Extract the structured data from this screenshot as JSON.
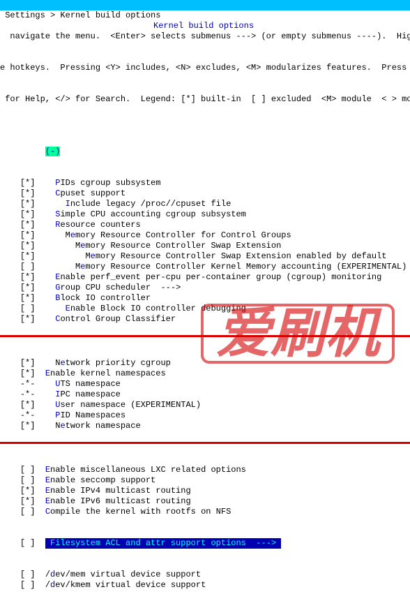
{
  "titlebar": {
    "breadcrumb": " Settings > Kernel build options",
    "title": "Kernel build options"
  },
  "help": {
    "l1": "  navigate the menu.  <Enter> selects submenus ---> (or empty submenus ----).  Highli",
    "l2": "e hotkeys.  Pressing <Y> includes, <N> excludes, <M> modularizes features.  Press <E",
    "l3": " for Help, </> for Search.  Legend: [*] built-in  [ ] excluded  <M> module  < > modul"
  },
  "marker": "(-)",
  "items": [
    {
      "b": "[*]",
      "i": 4,
      "m": "P",
      "t": "IDs cgroup subsystem"
    },
    {
      "b": "[*]",
      "i": 4,
      "m": "C",
      "t": "puset support"
    },
    {
      "b": "[*]",
      "i": 6,
      "m": "I",
      "t": "nclude legacy /proc/<pid>/cpuset file"
    },
    {
      "b": "[*]",
      "i": 4,
      "m": "S",
      "t": "imple CPU accounting cgroup subsystem"
    },
    {
      "b": "[*]",
      "i": 4,
      "m": "R",
      "t": "esource counters"
    },
    {
      "b": "[*]",
      "i": 6,
      "m": "M",
      "pre": "Me",
      "t": "mory Resource Controller for Control Groups"
    },
    {
      "b": "[*]",
      "i": 8,
      "m": "M",
      "pre": "Me",
      "t": "mory Resource Controller Swap Extension"
    },
    {
      "b": "[*]",
      "i": 10,
      "m": "M",
      "pre": "Me",
      "t": "mory Resource Controller Swap Extension enabled by default"
    },
    {
      "b": "[ ]",
      "i": 8,
      "m": "M",
      "pre": "Me",
      "t": "mory Resource Controller Kernel Memory accounting (EXPERIMENTAL)"
    },
    {
      "b": "[*]",
      "i": 4,
      "m": "E",
      "t": "nable perf_event per-cpu per-container group (cgroup) monitoring"
    },
    {
      "b": "[*]",
      "i": 4,
      "m": "G",
      "t": "roup CPU scheduler  --->"
    },
    {
      "b": "[*]",
      "i": 4,
      "m": "B",
      "t": "lock IO controller"
    },
    {
      "b": "[ ]",
      "i": 6,
      "m": "E",
      "t": "nable Block IO controller debugging"
    },
    {
      "b": "[*]",
      "i": 4,
      "m": "C",
      "t": "ontrol Group Classifier"
    }
  ],
  "items2": [
    {
      "b": "[*]",
      "i": 4,
      "m": "N",
      "pre": "Ne",
      "t": "twork priority cgroup"
    },
    {
      "b": "[*]",
      "i": 2,
      "m": "E",
      "t": "nable kernel namespaces"
    },
    {
      "b": "-*-",
      "i": 4,
      "m": "U",
      "t": "TS namespace"
    },
    {
      "b": "-*-",
      "i": 4,
      "m": "I",
      "t": "PC namespace"
    },
    {
      "b": "[*]",
      "i": 4,
      "m": "U",
      "t": "ser namespace (EXPERIMENTAL)"
    },
    {
      "b": "-*-",
      "i": 4,
      "m": "P",
      "t": "ID Namespaces"
    },
    {
      "b": "[*]",
      "i": 4,
      "m": "N",
      "pre": "Ne",
      "t": "twork namespace"
    }
  ],
  "items3": [
    {
      "b": "[ ]",
      "i": 2,
      "m": "E",
      "t": "nable miscellaneous LXC related options"
    },
    {
      "b": "[ ]",
      "i": 2,
      "m": "E",
      "t": "nable seccomp support"
    },
    {
      "b": "[*]",
      "i": 2,
      "m": "E",
      "t": "nable IPv4 multicast routing"
    },
    {
      "b": "[*]",
      "i": 2,
      "m": "E",
      "t": "nable IPv6 multicast routing"
    },
    {
      "b": "[ ]",
      "i": 2,
      "m": "C",
      "t": "ompile the kernel with rootfs on NFS"
    }
  ],
  "selected": {
    "b": "[ ]",
    "label": "Filesystem ACL and attr support options",
    "arrow": "  --->"
  },
  "items4": [
    {
      "b": "[ ]",
      "i": 2,
      "pre": "/",
      "m": "d",
      "t": "ev/mem virtual device support"
    },
    {
      "b": "[ ]",
      "i": 2,
      "pre": "/",
      "m": "d",
      "t": "ev/kmem virtual device support"
    }
  ],
  "watermark": "爱刷机"
}
